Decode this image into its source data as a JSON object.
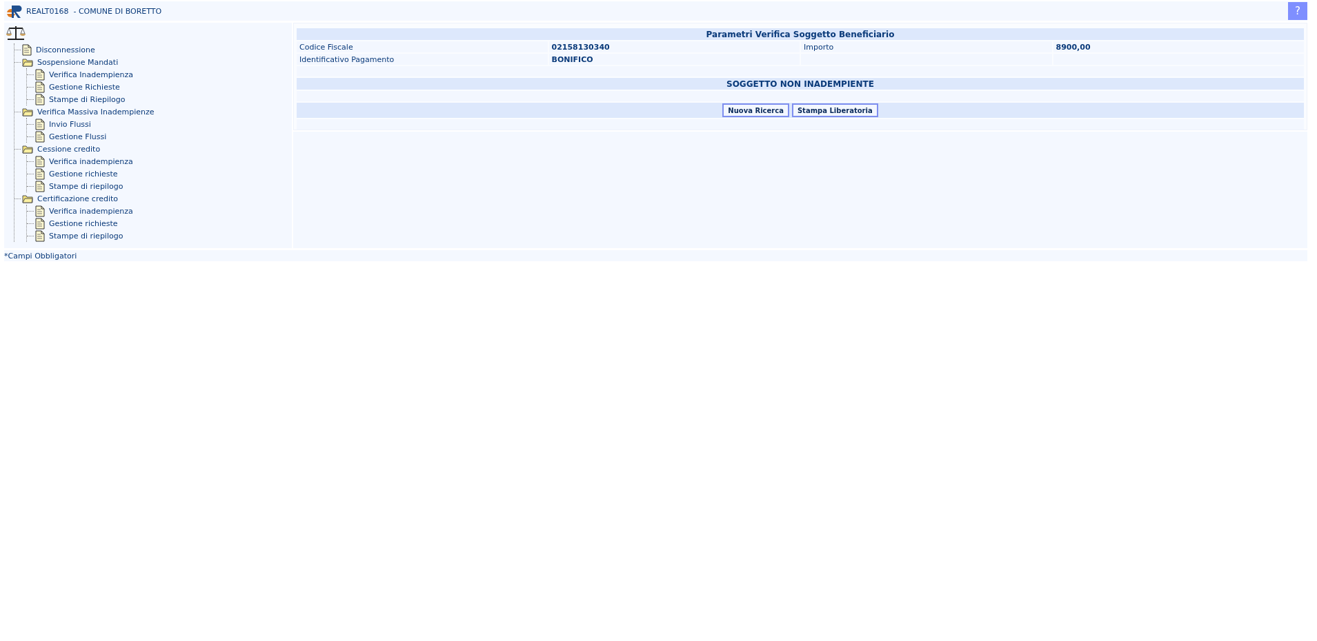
{
  "header": {
    "code": "REALT0168",
    "title": "- COMUNE DI BORETTO",
    "help": "?"
  },
  "tree": [
    {
      "kind": "page",
      "label": "Disconnessione"
    },
    {
      "kind": "folder",
      "label": "Sospensione Mandati",
      "expanded": true,
      "children": [
        {
          "kind": "page",
          "label": "Verifica Inadempienza"
        },
        {
          "kind": "page",
          "label": "Gestione Richieste"
        },
        {
          "kind": "page",
          "label": "Stampe di Riepilogo"
        }
      ]
    },
    {
      "kind": "folder",
      "label": "Verifica Massiva Inadempienze",
      "expanded": true,
      "children": [
        {
          "kind": "page",
          "label": "Invio Flussi"
        },
        {
          "kind": "page",
          "label": "Gestione Flussi"
        }
      ]
    },
    {
      "kind": "folder",
      "label": "Cessione credito",
      "expanded": true,
      "children": [
        {
          "kind": "page",
          "label": "Verifica inadempienza"
        },
        {
          "kind": "page",
          "label": "Gestione richieste"
        },
        {
          "kind": "page",
          "label": "Stampe di riepilogo"
        }
      ]
    },
    {
      "kind": "folder",
      "label": "Certificazione credito",
      "expanded": true,
      "children": [
        {
          "kind": "page",
          "label": "Verifica inadempienza"
        },
        {
          "kind": "page",
          "label": "Gestione richieste"
        },
        {
          "kind": "page",
          "label": "Stampe di riepilogo"
        }
      ]
    }
  ],
  "params": {
    "title": "Parametri Verifica Soggetto Beneficiario",
    "rows": [
      [
        {
          "label": "Codice Fiscale",
          "value": "02158130340"
        },
        {
          "label": "Importo",
          "value": "8900,00"
        }
      ],
      [
        {
          "label": "Identificativo Pagamento",
          "value": "BONIFICO"
        }
      ]
    ]
  },
  "status": "SOGGETTO NON INADEMPIENTE",
  "buttons": [
    "Nuova Ricerca",
    "Stampa Liberatoria"
  ],
  "footer_note": "*Campi Obbligatori"
}
